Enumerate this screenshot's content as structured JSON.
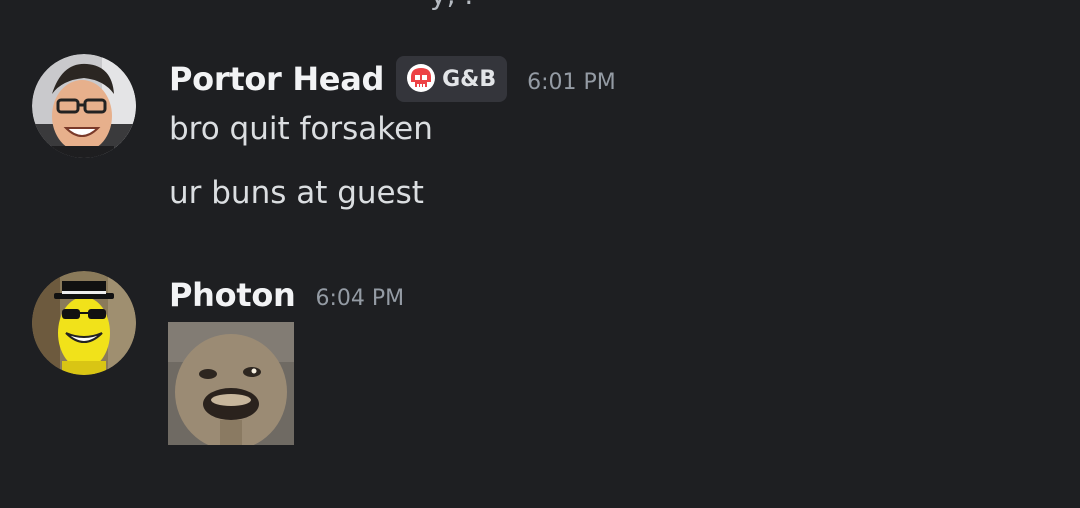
{
  "messages": [
    {
      "author": "Portor Head",
      "role_tag": {
        "icon": "skull-icon",
        "label": "G&B",
        "icon_color": "#ed4245"
      },
      "timestamp": "6:01 PM",
      "lines": [
        "bro quit forsaken",
        "ur buns at guest"
      ]
    },
    {
      "author": "Photon",
      "timestamp": "6:04 PM",
      "attachment": {
        "type": "image",
        "icon": "gif-image"
      }
    }
  ],
  "colors": {
    "background": "#1e1f22",
    "username": "#f2f3f5",
    "message_text": "#dbdee1",
    "timestamp": "#949ba4",
    "tag_background": "#34353b"
  }
}
